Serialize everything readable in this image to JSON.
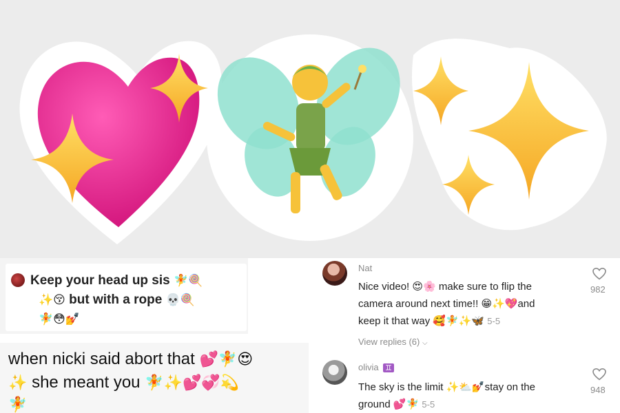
{
  "banner": {
    "stickers": [
      "sparkling-heart",
      "fairy",
      "sparkles"
    ]
  },
  "card1": {
    "line1_text": "Keep your head up sis",
    "line1_emoji": "🧚🍭",
    "line2_text": "but with a rope",
    "line2_pre_emoji": "✨😚",
    "line2_post_emoji": "💀🍭",
    "line3_emoji": "🧚😳💅"
  },
  "card2": {
    "line1_text": "when nicki said abort that",
    "line1_emoji": "💕🧚😍",
    "line2_pre_emoji": "✨",
    "line2_text": "she meant you",
    "line2_emoji": "🧚✨💕💞💫",
    "line3_emoji": "🧚"
  },
  "comments": [
    {
      "username": "Nat",
      "line1_text": "Nice video!",
      "line1_emoji": "😍🌸",
      "line1_rest": "make sure to flip the",
      "line2_text": "camera around next time!!",
      "line2_emoji": "😁✨💖",
      "line2_rest": "and",
      "line3_text": "keep it that way",
      "line3_emoji": "🥰🧚✨🦋",
      "date": "5-5",
      "likes": "982",
      "view_replies": "View replies (6)"
    },
    {
      "username": "olivia",
      "badge": "♊",
      "line1_text": "The sky is the limit",
      "line1_emoji": "✨⛅💅",
      "line1_rest": "stay on the",
      "line2_text": "ground",
      "line2_emoji": "💕🧚",
      "date": "5-5",
      "likes": "948"
    }
  ],
  "colors": {
    "heart_pink": "#e91e8c",
    "sparkle_yellow": "#fbc531",
    "fairy_wing": "#8fe0cf",
    "badge_purple": "#a259c4"
  }
}
